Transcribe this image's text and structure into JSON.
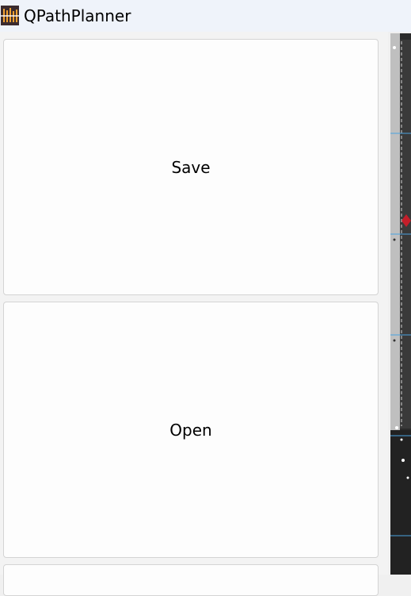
{
  "window": {
    "title": "QPathPlanner",
    "icon": "app-logo-icon"
  },
  "panel": {
    "save_label": "Save",
    "open_label": "Open",
    "third_label": ""
  },
  "colors": {
    "titlebar_bg": "#eff3fa",
    "button_bg": "#fdfdfd",
    "button_border": "#d4d4d4",
    "map_accent": "#4aa3e0",
    "map_marker": "#c41e2a"
  }
}
